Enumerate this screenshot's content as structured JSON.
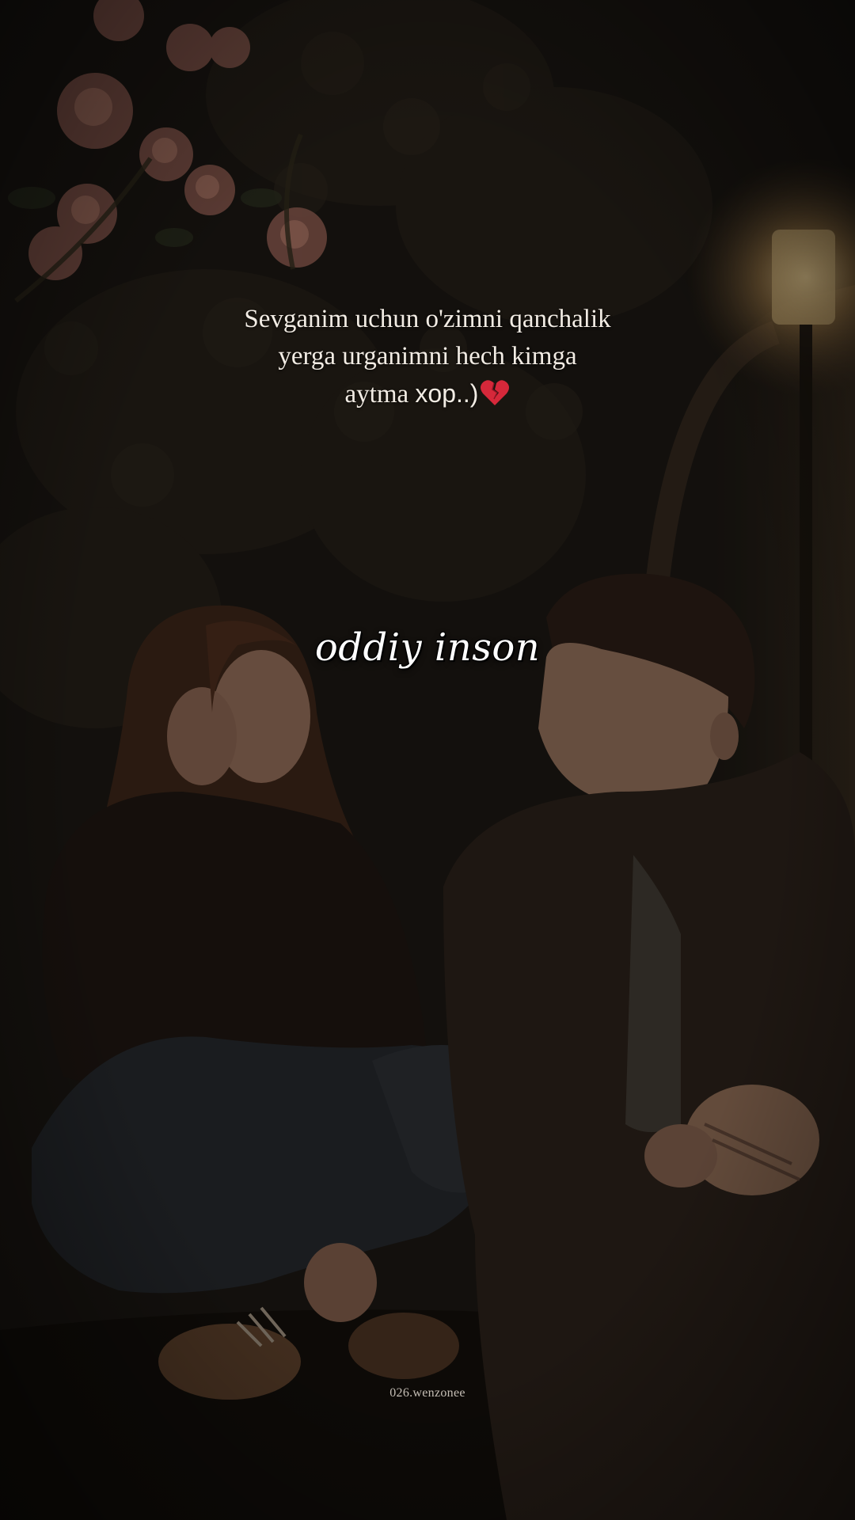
{
  "quote": {
    "line1": "Sevganim uchun o'zimni qanchalik",
    "line2": "yerga urganimni hech kimga",
    "line3_text": "aytma ",
    "line3_word": "xop..)",
    "emoji": "broken-heart-icon"
  },
  "watermark": "oddiy inson",
  "credit": "026.wenzonee"
}
